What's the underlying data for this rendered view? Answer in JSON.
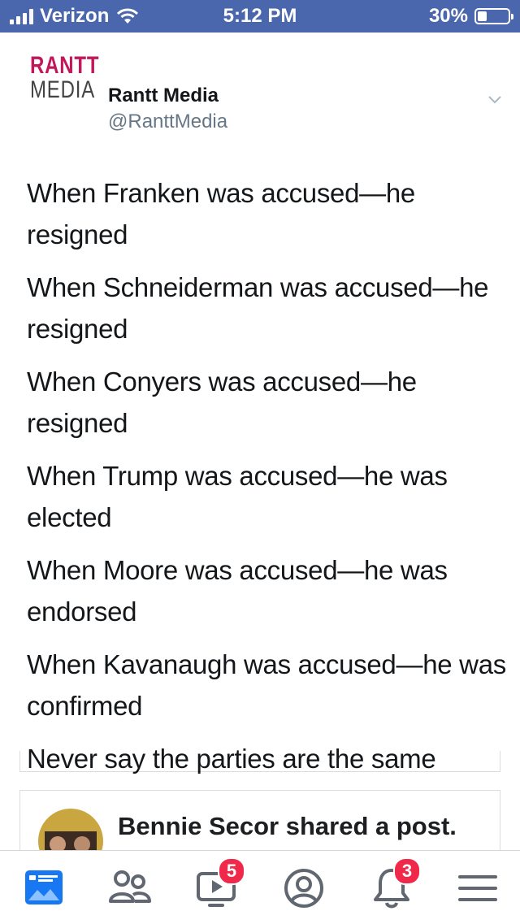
{
  "status_bar": {
    "carrier": "Verizon",
    "time": "5:12 PM",
    "battery_percent": "30%",
    "battery_level": 0.3,
    "background_color": "#4a66ad"
  },
  "tweet": {
    "logo": {
      "line1": "RANTT",
      "line2": "MEDIA"
    },
    "account_name": "Rantt Media",
    "handle": "@RanttMedia",
    "menu_icon": "chevron-down-icon",
    "lines": [
      "When Franken was accused—he resigned",
      "When Schneiderman was accused—he resigned",
      "When Conyers was accused—he resigned",
      "When Trump was accused—he was elected",
      "When Moore was accused—he was endorsed",
      "When Kavanaugh was accused—he was confirmed",
      "Never say the parties are the same"
    ]
  },
  "post": {
    "author": "Bennie Secor",
    "action": "shared a post."
  },
  "tab_bar": {
    "tabs": [
      {
        "icon": "news-feed-icon",
        "active": true
      },
      {
        "icon": "friends-icon"
      },
      {
        "icon": "watch-icon",
        "badge": "5"
      },
      {
        "icon": "profile-icon"
      },
      {
        "icon": "notifications-icon",
        "badge": "3"
      },
      {
        "icon": "menu-icon"
      }
    ],
    "active_color": "#1877f2",
    "icon_color": "#606770",
    "badge_color": "#f02849"
  }
}
